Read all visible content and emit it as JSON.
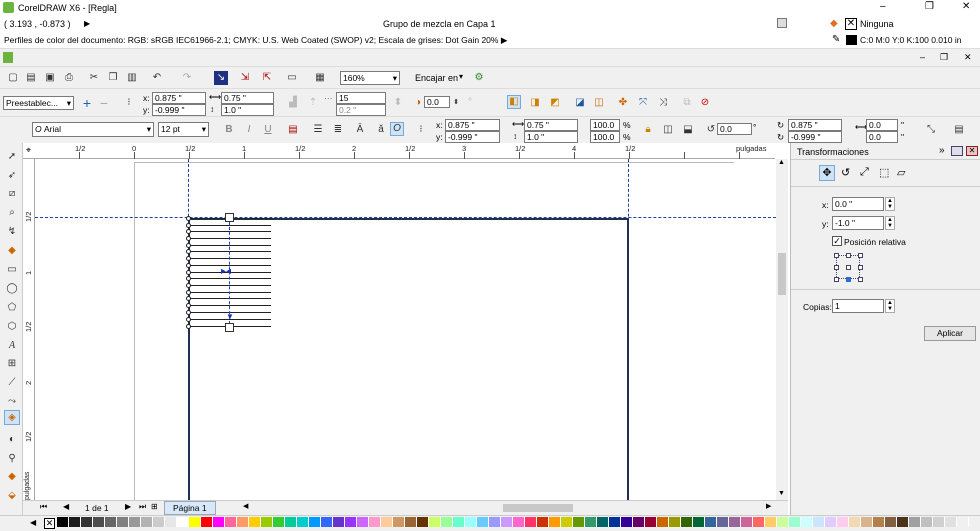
{
  "window": {
    "title": "CorelDRAW X6 - [Regla]",
    "buttons": [
      "–",
      "❐",
      "✕"
    ]
  },
  "status": {
    "coords": "( 3.193 , -0.873 )",
    "arrow": "▶",
    "object_info": "Grupo de mezcla en Capa 1",
    "fill_label": "Ninguna",
    "outline_info": "C:0 M:0 Y:0 K:100  0.010 in",
    "color_profiles": "Perfiles de color del documento: RGB: sRGB IEC61966-2.1; CMYK: U.S. Web Coated (SWOP) v2; Escala de grises: Dot Gain 20% ▶"
  },
  "toolbar": {
    "zoom": "160%",
    "snap_label": "Encajar en",
    "presets": "Preestablec..."
  },
  "property_bar": {
    "x": "0.875 \"",
    "y": "-0.999 \"",
    "width": "0.75 \"",
    "height": "1.0 \"",
    "steps": "15",
    "spacing": "0.2 \"",
    "rotation": "0.0"
  },
  "text_bar": {
    "font": "Arial",
    "size": "12 pt",
    "x": "0.875 \"",
    "y": "-0.999 \"",
    "w": "0.75 \"",
    "h": "1.0 \"",
    "scale_w": "100.0",
    "scale_h": "100.0",
    "percent": "%",
    "rotation": "0.0",
    "pos_x": "0.875 \"",
    "pos_y": "-0.999 \"",
    "dup_x": "0.0",
    "dup_y": "0.0"
  },
  "ruler": {
    "h_labels": [
      "1/2",
      "0",
      "1/2",
      "1",
      "1/2",
      "2",
      "1/2",
      "3",
      "1/2",
      "4",
      "1/2"
    ],
    "units": "pulgadas",
    "v_labels": [
      "1/2",
      "1",
      "1/2",
      "2",
      "1/2"
    ],
    "v_units": "pulgadas"
  },
  "transform_panel": {
    "title": "Transformaciones",
    "x_label": "x:",
    "x_value": "0.0 \"",
    "y_label": "y:",
    "y_value": "-1.0 \"",
    "relative_label": "Posición relativa",
    "relative_checked": true,
    "copies_label": "Copias:",
    "copies_value": "1",
    "apply_label": "Aplicar"
  },
  "pages": {
    "counter": "1 de 1",
    "tab": "Página 1"
  },
  "palette": [
    "#000000",
    "#1a1a1a",
    "#333333",
    "#4d4d4d",
    "#666666",
    "#808080",
    "#999999",
    "#b3b3b3",
    "#cccccc",
    "#e6e6e6",
    "#ffffff",
    "#ffff00",
    "#ff0000",
    "#ff00ff",
    "#ff6699",
    "#ff9966",
    "#ffcc00",
    "#99cc00",
    "#33cc33",
    "#00cc99",
    "#00cccc",
    "#0099ff",
    "#3366ff",
    "#6633cc",
    "#9933ff",
    "#cc66ff",
    "#ff99cc",
    "#ffcc99",
    "#cc9966",
    "#996633",
    "#663300",
    "#ccff66",
    "#99ff99",
    "#66ffcc",
    "#99ffff",
    "#66ccff",
    "#9999ff",
    "#cc99ff",
    "#ff66cc",
    "#ff3366",
    "#cc3300",
    "#ff9900",
    "#cccc00",
    "#669900",
    "#339966",
    "#006666",
    "#003399",
    "#330099",
    "#660066",
    "#990033",
    "#cc6600",
    "#999900",
    "#336600",
    "#006633",
    "#336699",
    "#666699",
    "#996699",
    "#cc6699",
    "#ff6666",
    "#ffcc66",
    "#ccff99",
    "#99ffcc",
    "#ccffff",
    "#cce5ff",
    "#e0ccff",
    "#ffccee",
    "#f2d9b3",
    "#d9b38c",
    "#b3804d",
    "#806040",
    "#4d3319",
    "#a0a0a0",
    "#c0c0c0",
    "#d0d0d0",
    "#e0e0e0",
    "#f0f0f0"
  ]
}
